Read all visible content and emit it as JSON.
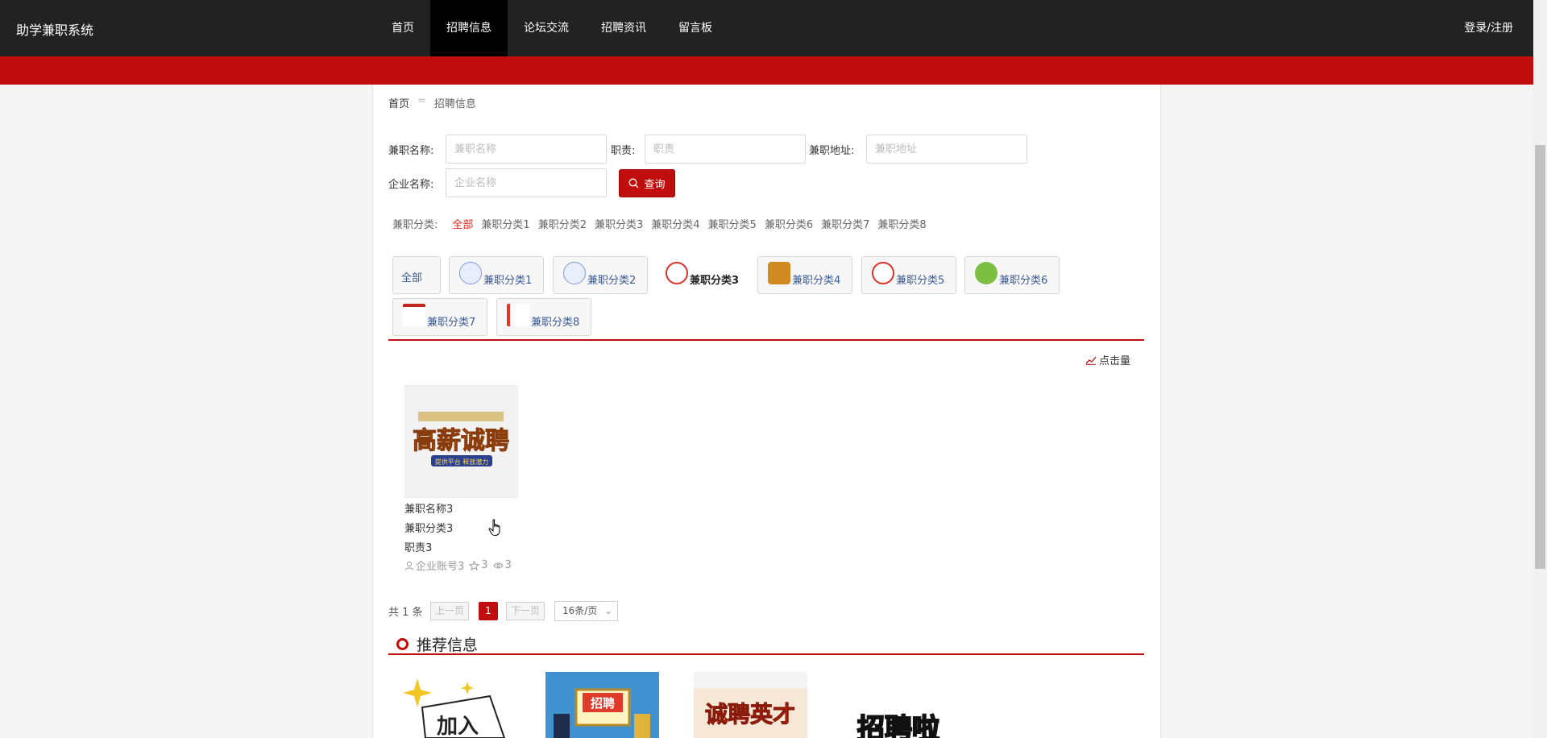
{
  "header": {
    "brand": "助学兼职系统",
    "nav": [
      "首页",
      "招聘信息",
      "论坛交流",
      "招聘资讯",
      "留言板"
    ],
    "active_nav": "招聘信息",
    "login": "登录/注册"
  },
  "breadcrumb": {
    "home": "首页",
    "sep": "=",
    "current": "招聘信息"
  },
  "search": {
    "name_label": "兼职名称:",
    "name_placeholder": "兼职名称",
    "duty_label": "职责:",
    "duty_placeholder": "职责",
    "address_label": "兼职地址:",
    "address_placeholder": "兼职地址",
    "company_label": "企业名称:",
    "company_placeholder": "企业名称",
    "query_button": "查询"
  },
  "category_filter": {
    "label": "兼职分类:",
    "items": [
      "全部",
      "兼职分类1",
      "兼职分类2",
      "兼职分类3",
      "兼职分类4",
      "兼职分类5",
      "兼职分类6",
      "兼职分类7",
      "兼职分类8"
    ],
    "active": "全部"
  },
  "category_tiles": [
    "全部",
    "兼职分类1",
    "兼职分类2",
    "兼职分类3",
    "兼职分类4",
    "兼职分类5",
    "兼职分类6",
    "兼职分类7",
    "兼职分类8"
  ],
  "selected_tile": "兼职分类3",
  "sort": {
    "clicks": "点击量"
  },
  "job_card": {
    "name": "兼职名称3",
    "category": "兼职分类3",
    "duty": "职责3",
    "company": "企业账号3",
    "stars": "3",
    "views": "3",
    "image_text": "高薪诚聘",
    "image_subtext": "提供平台 释放潜力"
  },
  "pagination": {
    "total": "共 1 条",
    "prev": "上一页",
    "page": "1",
    "next": "下一页",
    "page_size": "16条/页"
  },
  "recommend": {
    "title": "推荐信息",
    "images": [
      "加入",
      "招聘",
      "诚聘英才",
      "招聘啦"
    ]
  },
  "colors": {
    "primary_red": "#c00d0d",
    "nav_bg": "#222222",
    "link_blue": "#3a5b96"
  }
}
